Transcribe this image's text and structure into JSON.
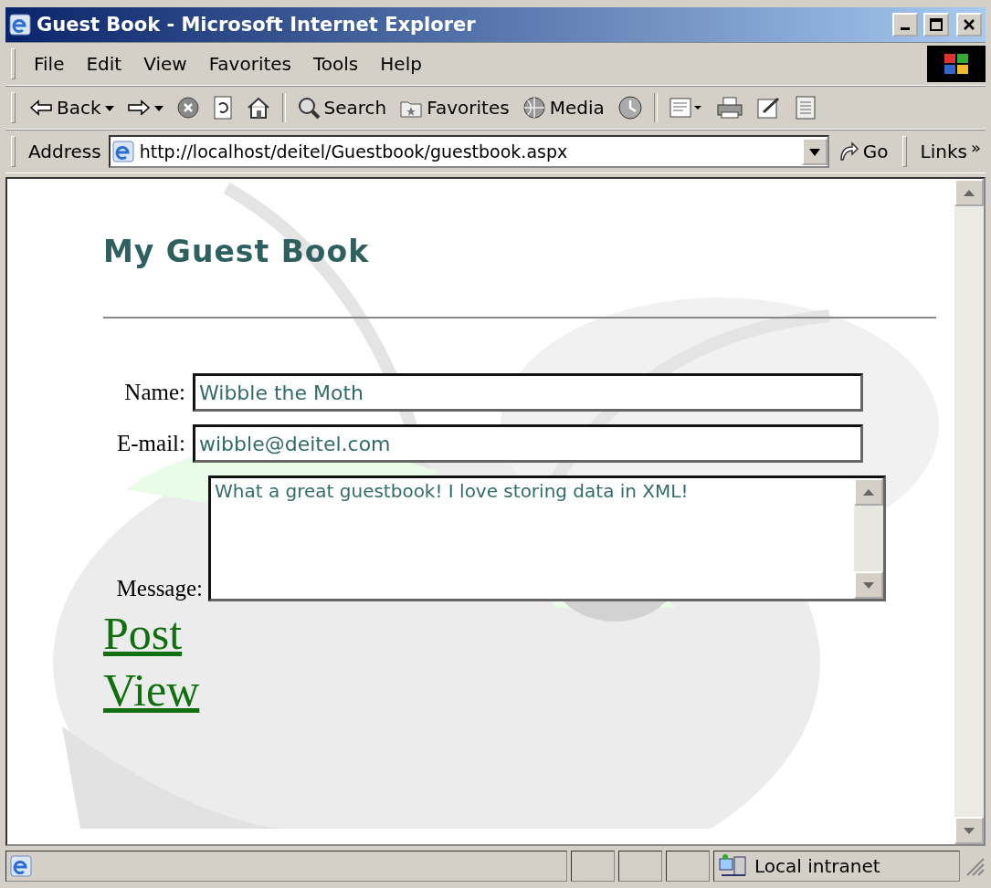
{
  "window": {
    "title": "Guest Book - Microsoft Internet Explorer"
  },
  "menu": [
    "File",
    "Edit",
    "View",
    "Favorites",
    "Tools",
    "Help"
  ],
  "toolbar": [
    {
      "kind": "back",
      "label": "Back"
    },
    {
      "kind": "forward"
    },
    {
      "kind": "stop"
    },
    {
      "kind": "refresh"
    },
    {
      "kind": "home"
    },
    {
      "kind": "search",
      "label": "Search"
    },
    {
      "kind": "favorites",
      "label": "Favorites"
    },
    {
      "kind": "media",
      "label": "Media"
    },
    {
      "kind": "history"
    },
    {
      "kind": "mail"
    },
    {
      "kind": "print"
    },
    {
      "kind": "edit"
    },
    {
      "kind": "discuss"
    }
  ],
  "address_bar": {
    "label": "Address",
    "value": "http://localhost/deitel/Guestbook/guestbook.aspx",
    "go": "Go",
    "links": "Links",
    "links_more": "»"
  },
  "page": {
    "heading": "My Guest Book",
    "fields": [
      {
        "kind": "input",
        "label": "Name:",
        "value": "Wibble the Moth"
      },
      {
        "kind": "input",
        "label": "E-mail:",
        "value": "wibble@deitel.com"
      },
      {
        "kind": "textarea",
        "label": "Message:",
        "value": "What a great guestbook! I love storing data in XML!"
      }
    ],
    "links": [
      "Post",
      "View"
    ]
  },
  "status_bar": {
    "zone": "Local intranet"
  }
}
